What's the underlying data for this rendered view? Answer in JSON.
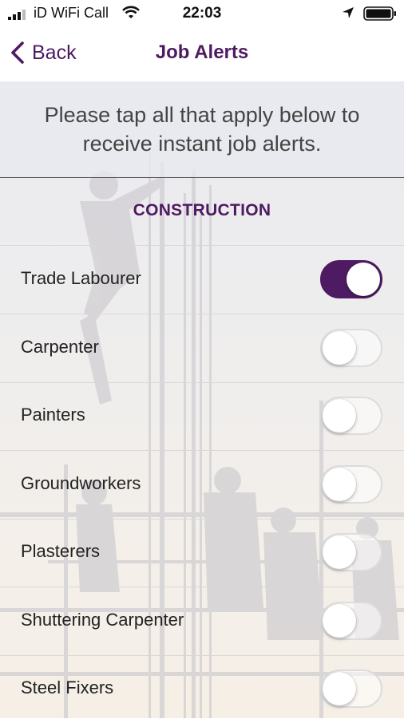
{
  "status_bar": {
    "carrier": "iD WiFi Call",
    "time": "22:03"
  },
  "nav": {
    "back_label": "Back",
    "title": "Job Alerts"
  },
  "instructions": "Please tap all that apply below to receive instant job alerts.",
  "section": {
    "title": "CONSTRUCTION"
  },
  "jobs": [
    {
      "label": "Trade Labourer",
      "enabled": true
    },
    {
      "label": "Carpenter",
      "enabled": false
    },
    {
      "label": "Painters",
      "enabled": false
    },
    {
      "label": "Groundworkers",
      "enabled": false
    },
    {
      "label": "Plasterers",
      "enabled": false
    },
    {
      "label": "Shuttering Carpenter",
      "enabled": false
    },
    {
      "label": "Steel Fixers",
      "enabled": false
    }
  ],
  "colors": {
    "accent": "#4e1a61"
  }
}
